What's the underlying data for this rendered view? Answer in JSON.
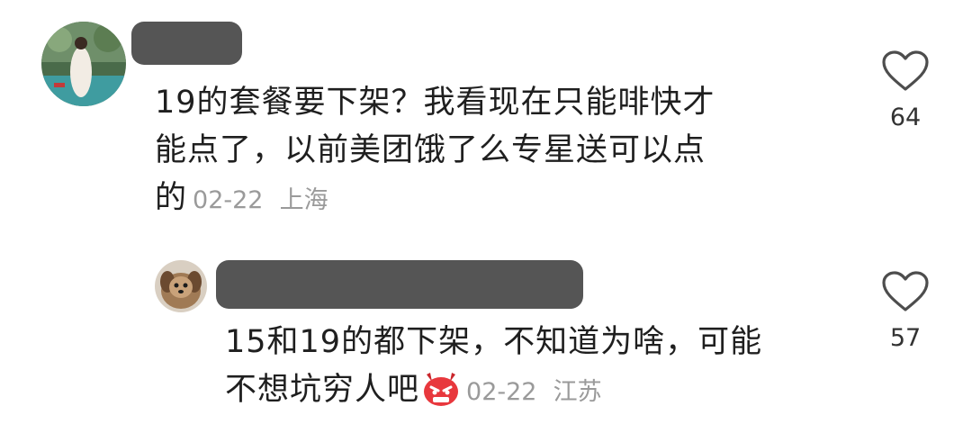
{
  "comments": [
    {
      "text_lines": [
        "19的套餐要下架？我看现在只能啡快才",
        "能点了，以前美团饿了么专星送可以点",
        "的"
      ],
      "date": "02-22",
      "location": "上海",
      "likes": "64",
      "avatar_icon": "user-avatar-photo-woman"
    }
  ],
  "replies": [
    {
      "text_lines": [
        "15和19的都下架，不知道为啥，可能",
        "不想坑穷人吧"
      ],
      "emoji": "angry-devil-emoji",
      "date": "02-22",
      "location": "江苏",
      "likes": "57",
      "avatar_icon": "user-avatar-photo-dog"
    }
  ],
  "colors": {
    "text": "#1f1f1f",
    "meta": "#9a9a9a",
    "redaction": "#555555",
    "emoji": "#e8383d"
  }
}
